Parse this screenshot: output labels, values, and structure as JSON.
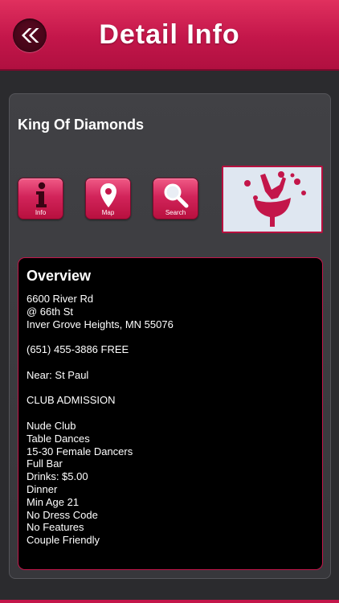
{
  "header": {
    "title": "Detail Info"
  },
  "place": {
    "name": "King Of Diamonds"
  },
  "actions": [
    {
      "label": "Info",
      "icon": "info-icon"
    },
    {
      "label": "Map",
      "icon": "map-pin-icon"
    },
    {
      "label": "Search",
      "icon": "magnifier-icon"
    }
  ],
  "overview": {
    "title": "Overview",
    "lines": [
      "6600 River Rd",
      "@ 66th St",
      "Inver Grove Heights, MN 55076",
      "",
      "(651) 455-3886 FREE",
      "",
      "Near: St Paul",
      "",
      "CLUB ADMISSION",
      "",
      "Nude Club",
      "Table Dances",
      "15-30 Female Dancers",
      "Full Bar",
      "Drinks: $5.00",
      "Dinner",
      "Min Age 21",
      "No Dress Code",
      "No Features",
      "Couple Friendly"
    ]
  },
  "colors": {
    "accent": "#c3164a",
    "background": "#2b2b2e",
    "panel": "#3c3c40"
  }
}
